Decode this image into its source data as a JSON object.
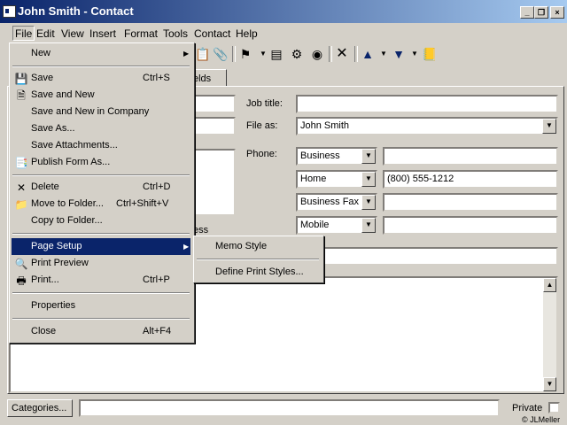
{
  "window": {
    "title": "John Smith - Contact"
  },
  "menubar": {
    "items": [
      "File",
      "Edit",
      "View",
      "Insert",
      "Format",
      "Tools",
      "Contact",
      "Help"
    ]
  },
  "tab": {
    "partial_label": "elds"
  },
  "form": {
    "job_title_label": "Job title:",
    "file_as_label": "File as:",
    "file_as_value": "John Smith",
    "phone_label": "Phone:",
    "phones": [
      {
        "type": "Business",
        "value": ""
      },
      {
        "type": "Home",
        "value": "(800) 555-1212"
      },
      {
        "type": "Business Fax",
        "value": ""
      },
      {
        "type": "Mobile",
        "value": ""
      }
    ],
    "partial_label": "ess",
    "categories_label": "Categories...",
    "private_label": "Private",
    "credit": "© JLMeller"
  },
  "file_menu": {
    "items": [
      {
        "label": "New",
        "shortcut": "",
        "icon": ""
      },
      {
        "label": "Save",
        "shortcut": "Ctrl+S",
        "icon": "save-icon"
      },
      {
        "label": "Save and New",
        "shortcut": "",
        "icon": "save-new-icon"
      },
      {
        "label": "Save and New in Company",
        "shortcut": "",
        "icon": ""
      },
      {
        "label": "Save As...",
        "shortcut": "",
        "icon": ""
      },
      {
        "label": "Save Attachments...",
        "shortcut": "",
        "icon": ""
      },
      {
        "label": "Publish Form As...",
        "shortcut": "",
        "icon": "publish-icon"
      },
      {
        "label": "Delete",
        "shortcut": "Ctrl+D",
        "icon": "delete-icon"
      },
      {
        "label": "Move to Folder...",
        "shortcut": "Ctrl+Shift+V",
        "icon": "folder-icon"
      },
      {
        "label": "Copy to Folder...",
        "shortcut": "",
        "icon": ""
      },
      {
        "label": "Page Setup",
        "shortcut": "",
        "icon": ""
      },
      {
        "label": "Print Preview",
        "shortcut": "",
        "icon": "print-preview-icon"
      },
      {
        "label": "Print...",
        "shortcut": "Ctrl+P",
        "icon": "printer-icon"
      },
      {
        "label": "Properties",
        "shortcut": "",
        "icon": ""
      },
      {
        "label": "Close",
        "shortcut": "Alt+F4",
        "icon": ""
      }
    ]
  },
  "page_setup_submenu": {
    "items": [
      "Memo Style",
      "Define Print Styles..."
    ]
  }
}
